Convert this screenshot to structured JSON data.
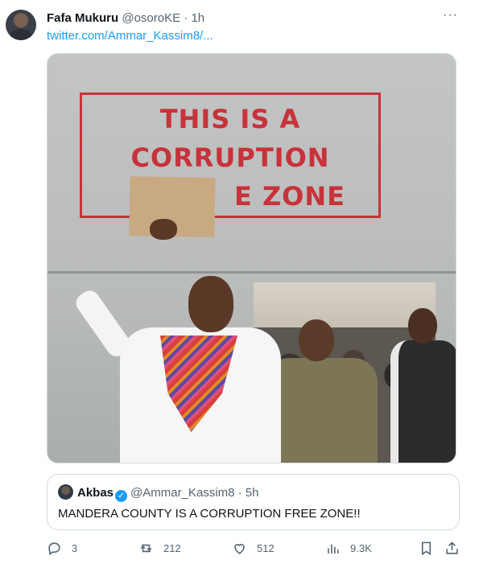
{
  "tweet": {
    "author_name": "Fafa Mukuru",
    "handle": "@osoroKE",
    "separator": "·",
    "time": "1h",
    "link": "twitter.com/Ammar_Kassim8/...",
    "more_icon": "more-dots-icon",
    "image": {
      "sign_line1": "THIS IS A",
      "sign_line2": "CORRUPTION",
      "sign_line3": "E ZONE"
    }
  },
  "quote": {
    "author_name": "Akbas",
    "handle": "@Ammar_Kassim8",
    "separator": "·",
    "time": "5h",
    "text": "MANDERA COUNTY IS A CORRUPTION FREE ZONE!!"
  },
  "actions": {
    "replies": "3",
    "retweets": "212",
    "likes": "512",
    "views": "9.3K",
    "icons": [
      "reply-icon",
      "retweet-icon",
      "like-icon",
      "views-icon",
      "bookmark-icon",
      "share-icon"
    ]
  },
  "colors": {
    "link": "#1d9bf0",
    "muted": "#536471",
    "sign_red": "#c8323a"
  }
}
